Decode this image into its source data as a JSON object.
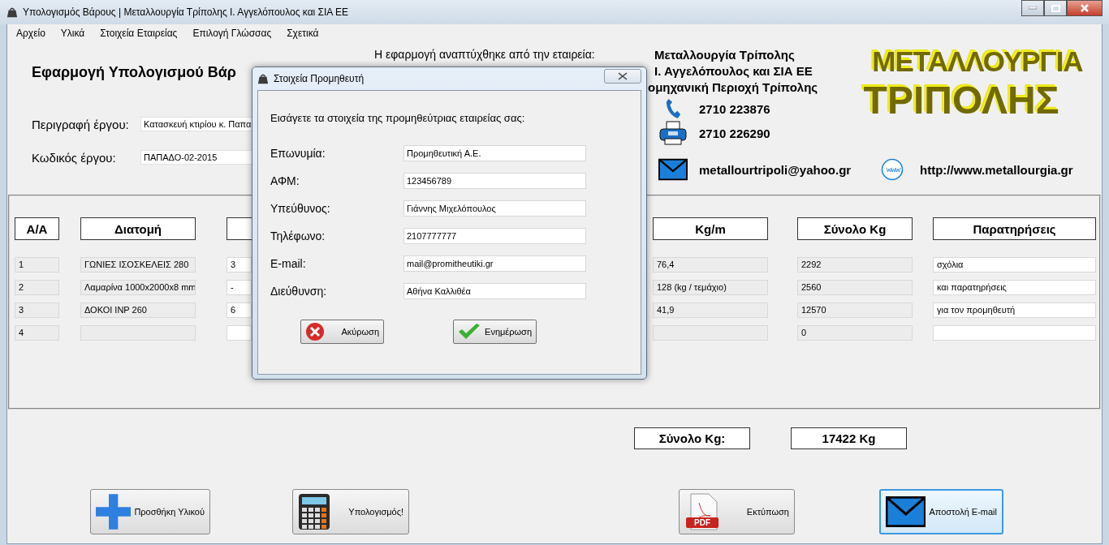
{
  "window": {
    "title": "Υπολογισμός Βάρους | Μεταλλουργία Τρίπολης Ι. Αγγελόπουλος και ΣΙΑ ΕΕ"
  },
  "menu": [
    "Αρχείο",
    "Υλικά",
    "Στοιχεία Εταιρείας",
    "Επιλογή Γλώσσας",
    "Σχετικά"
  ],
  "app_title": "Εφαρμογή Υπολογισμού Βάρ",
  "project_fields": [
    {
      "label": "Περιγραφή έργου:",
      "value": "Κατασκευή κτιρίου κ. Παπα"
    },
    {
      "label": "Κωδικός έργου:",
      "value": "ΠΑΠΑΔΟ-02-2015"
    }
  ],
  "developer": {
    "intro": "Η εφαρμογή αναπτύχθηκε από την εταιρεία:",
    "company_lines": [
      "Μεταλλουργία Τρίπολης",
      "Ι. Αγγελόπουλος και ΣΙΑ ΕΕ",
      "ομηχανική Περιοχή Τρίπολης"
    ],
    "contacts": [
      {
        "kind": "phone",
        "text": "2710 223876"
      },
      {
        "kind": "fax",
        "text": "2710 226290"
      },
      {
        "kind": "email",
        "text": "metallourtripoli@yahoo.gr"
      }
    ],
    "website": "http://www.metallourgia.gr"
  },
  "logo": {
    "lines": [
      "ΜΕΤΑΛΛΟΥΡΓΙΑ",
      "ΤΡΙΠΟΛΗΣ"
    ]
  },
  "table": {
    "columns": [
      "Α/Α",
      "Διατομή",
      "Kg/m",
      "Σύνολο Kg",
      "Παρατηρήσεις"
    ],
    "rows": [
      {
        "aa": "1",
        "section": "ΓΩΝΙΕΣ ΙΣΟΣΚΕΛΕΙΣ 280",
        "column_3": "3",
        "kg_m": "76,4",
        "total": "2292",
        "notes": "σχόλια"
      },
      {
        "aa": "2",
        "section": "Λαμαρίνα 1000x2000x8 mm",
        "column_3": "-",
        "kg_m": "128 (kg / τεμάχιο)",
        "total": "2560",
        "notes": "και παρατηρήσεις"
      },
      {
        "aa": "3",
        "section": "ΔΟΚΟΙ INP 260",
        "column_3": "6",
        "kg_m": "41,9",
        "total": "12570",
        "notes": "για τον προμηθευτή"
      },
      {
        "aa": "4",
        "total": "0"
      }
    ]
  },
  "totals": {
    "label": "Σύνολο Kg:",
    "value": "17422 Kg"
  },
  "buttons": [
    {
      "kind": "add",
      "label": "Προσθήκη Υλικού",
      "focused": false
    },
    {
      "kind": "calculator",
      "label": "Υπολογισμός!",
      "focused": false
    },
    {
      "kind": "pdf",
      "label": "Εκτύπωση",
      "icon_text": "PDF",
      "focused": false
    },
    {
      "kind": "email",
      "label": "Αποστολή E-mail",
      "focused": true
    }
  ],
  "dialog": {
    "title": "Στοιχεία Προμηθευτή",
    "prompt": "Εισάγετε τα στοιχεία της προμηθεύτριας εταιρείας σας:",
    "fields": [
      {
        "label": "Επωνυμία:",
        "value": "Προμηθευτική Α.Ε."
      },
      {
        "label": "ΑΦΜ:",
        "value": "123456789"
      },
      {
        "label": "Υπεύθυνος:",
        "value": "Γιάννης Μιχελόπουλος"
      },
      {
        "label": "Τηλέφωνο:",
        "value": "2107777777"
      },
      {
        "label": "E-mail:",
        "value": "mail@promitheutiki.gr"
      },
      {
        "label": "Διεύθυνση:",
        "value": "Αθήνα Καλλιθέα"
      }
    ],
    "buttons": [
      {
        "kind": "cancel",
        "label": "Ακύρωση"
      },
      {
        "kind": "confirm",
        "label": "Ενημέρωση"
      }
    ]
  }
}
